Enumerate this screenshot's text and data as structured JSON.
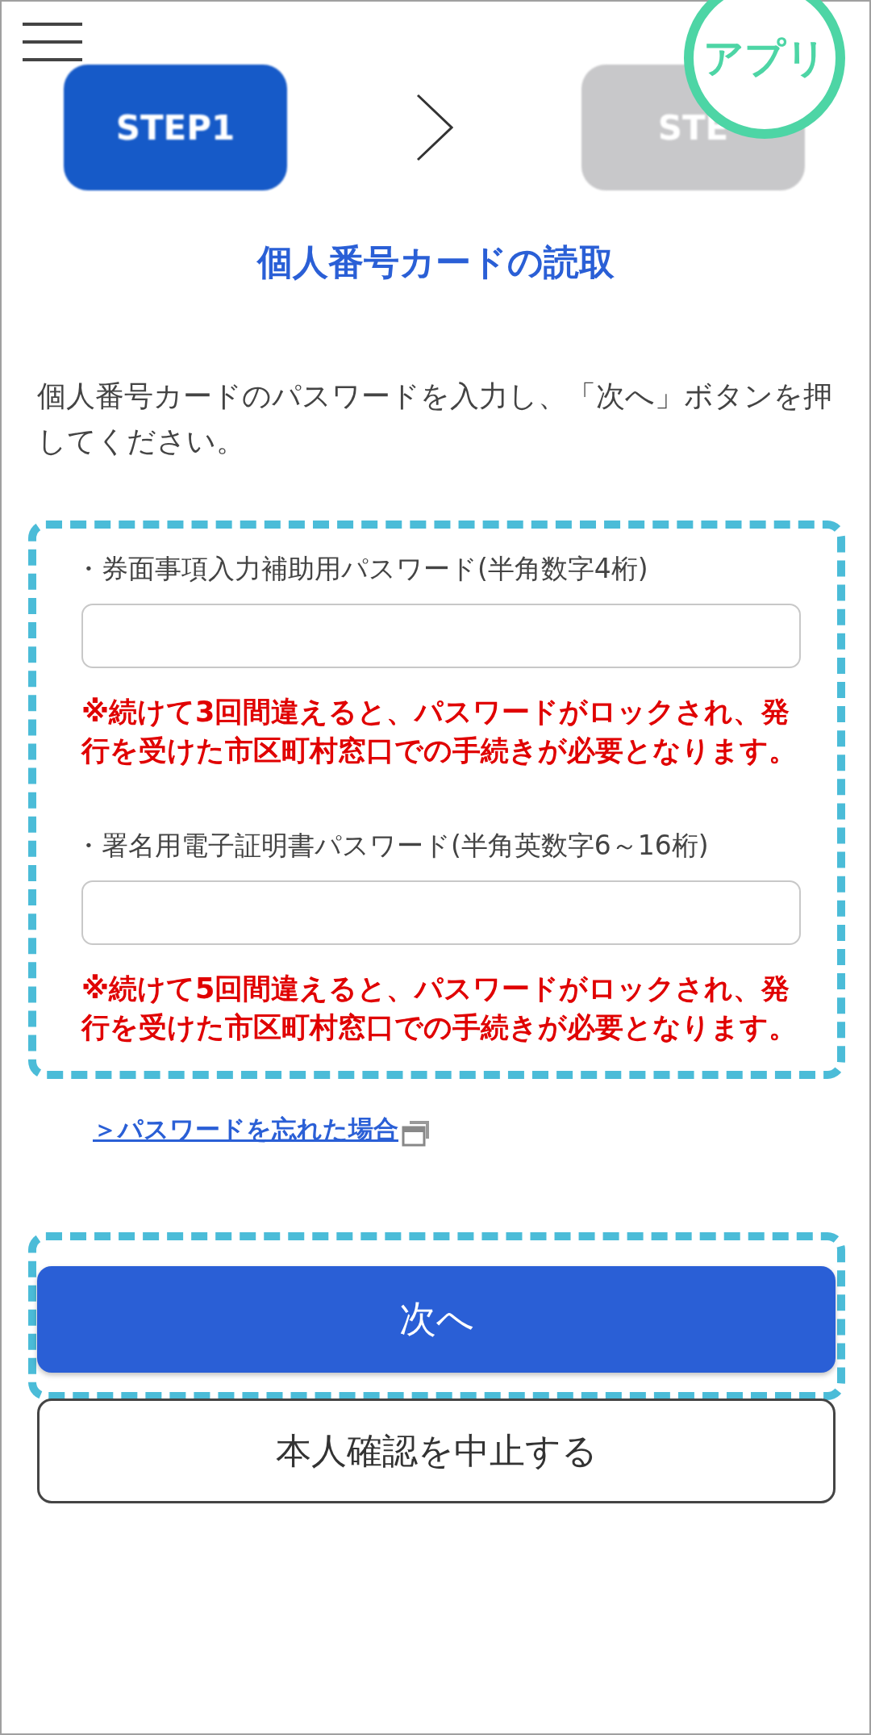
{
  "steps": [
    {
      "label": "STEP1",
      "selected": true
    },
    {
      "label": "STE",
      "selected": false
    }
  ],
  "badge": "アプリ",
  "title": "個人番号カードの読取",
  "instruction": "個人番号カードのパスワードを入力し、「次へ」ボタンを押してください。",
  "fields": [
    {
      "label": "・券面事項入力補助用パスワード(半角数字4桁)",
      "warning": "※続けて3回間違えると、パスワードがロックされ、発行を受けた市区町村窓口での手続きが必要となります。"
    },
    {
      "label": "・署名用電子証明書パスワード(半角英数字6～16桁)",
      "warning": "※続けて5回間違えると、パスワードがロックされ、発行を受けた市区町村窓口での手続きが必要となります。"
    }
  ],
  "forgot_link": "＞パスワードを忘れた場合",
  "next_button": "次へ",
  "cancel_button": "本人確認を中止する"
}
